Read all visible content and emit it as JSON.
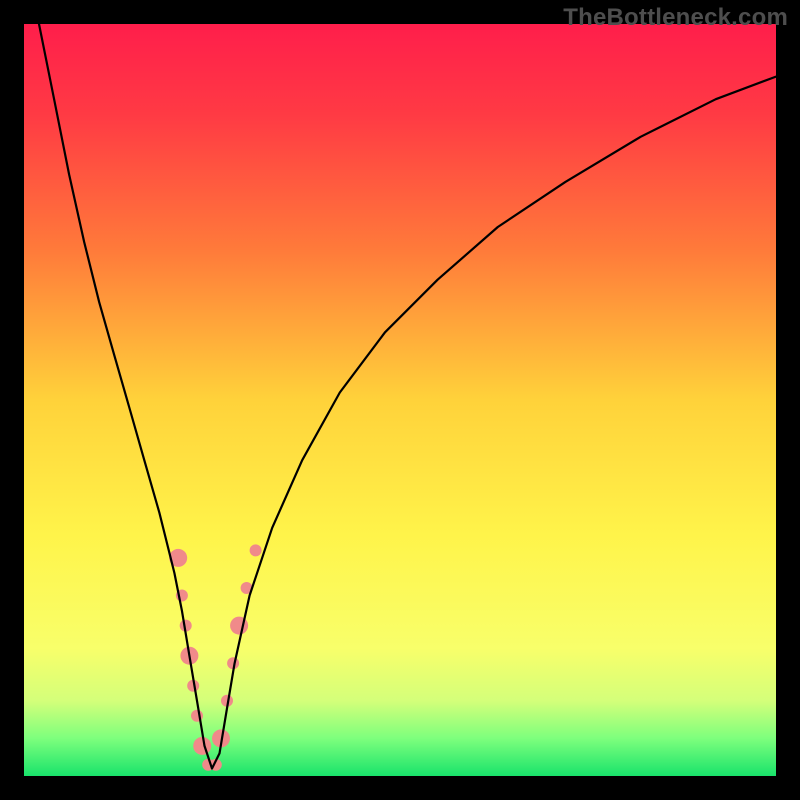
{
  "watermark": {
    "text": "TheBottleneck.com"
  },
  "gradient": {
    "stops": [
      {
        "pct": 0,
        "color": "#ff1e4b"
      },
      {
        "pct": 12,
        "color": "#ff3a44"
      },
      {
        "pct": 30,
        "color": "#ff7a3a"
      },
      {
        "pct": 50,
        "color": "#ffd23a"
      },
      {
        "pct": 68,
        "color": "#fff44a"
      },
      {
        "pct": 83,
        "color": "#f8ff6a"
      },
      {
        "pct": 90,
        "color": "#d4ff7a"
      },
      {
        "pct": 95,
        "color": "#7dff7d"
      },
      {
        "pct": 100,
        "color": "#19e36b"
      }
    ]
  },
  "chart_data": {
    "type": "line",
    "title": "",
    "xlabel": "",
    "ylabel": "",
    "xlim": [
      0,
      100
    ],
    "ylim": [
      0,
      100
    ],
    "grid": false,
    "legend": false,
    "series": [
      {
        "name": "bottleneck-curve",
        "color": "#000000",
        "stroke_width": 2.2,
        "x": [
          2,
          4,
          6,
          8,
          10,
          12,
          14,
          16,
          18,
          20,
          21,
          22,
          23,
          24,
          25,
          26,
          27,
          28,
          30,
          33,
          37,
          42,
          48,
          55,
          63,
          72,
          82,
          92,
          100
        ],
        "y": [
          100,
          90,
          80,
          71,
          63,
          56,
          49,
          42,
          35,
          27,
          22,
          16,
          10,
          4,
          1,
          3,
          9,
          15,
          24,
          33,
          42,
          51,
          59,
          66,
          73,
          79,
          85,
          90,
          93
        ]
      }
    ],
    "markers": {
      "name": "highlight-dots",
      "color": "#f08a8a",
      "radius_major": 9,
      "radius_minor": 6,
      "points": [
        {
          "x": 20.5,
          "y": 29
        },
        {
          "x": 21.0,
          "y": 24
        },
        {
          "x": 21.5,
          "y": 20
        },
        {
          "x": 22.0,
          "y": 16
        },
        {
          "x": 22.5,
          "y": 12
        },
        {
          "x": 23.0,
          "y": 8
        },
        {
          "x": 23.7,
          "y": 4
        },
        {
          "x": 24.5,
          "y": 1.5
        },
        {
          "x": 25.5,
          "y": 1.5
        },
        {
          "x": 26.2,
          "y": 5
        },
        {
          "x": 27.0,
          "y": 10
        },
        {
          "x": 27.8,
          "y": 15
        },
        {
          "x": 28.6,
          "y": 20
        },
        {
          "x": 29.6,
          "y": 25
        },
        {
          "x": 30.8,
          "y": 30
        }
      ]
    }
  }
}
